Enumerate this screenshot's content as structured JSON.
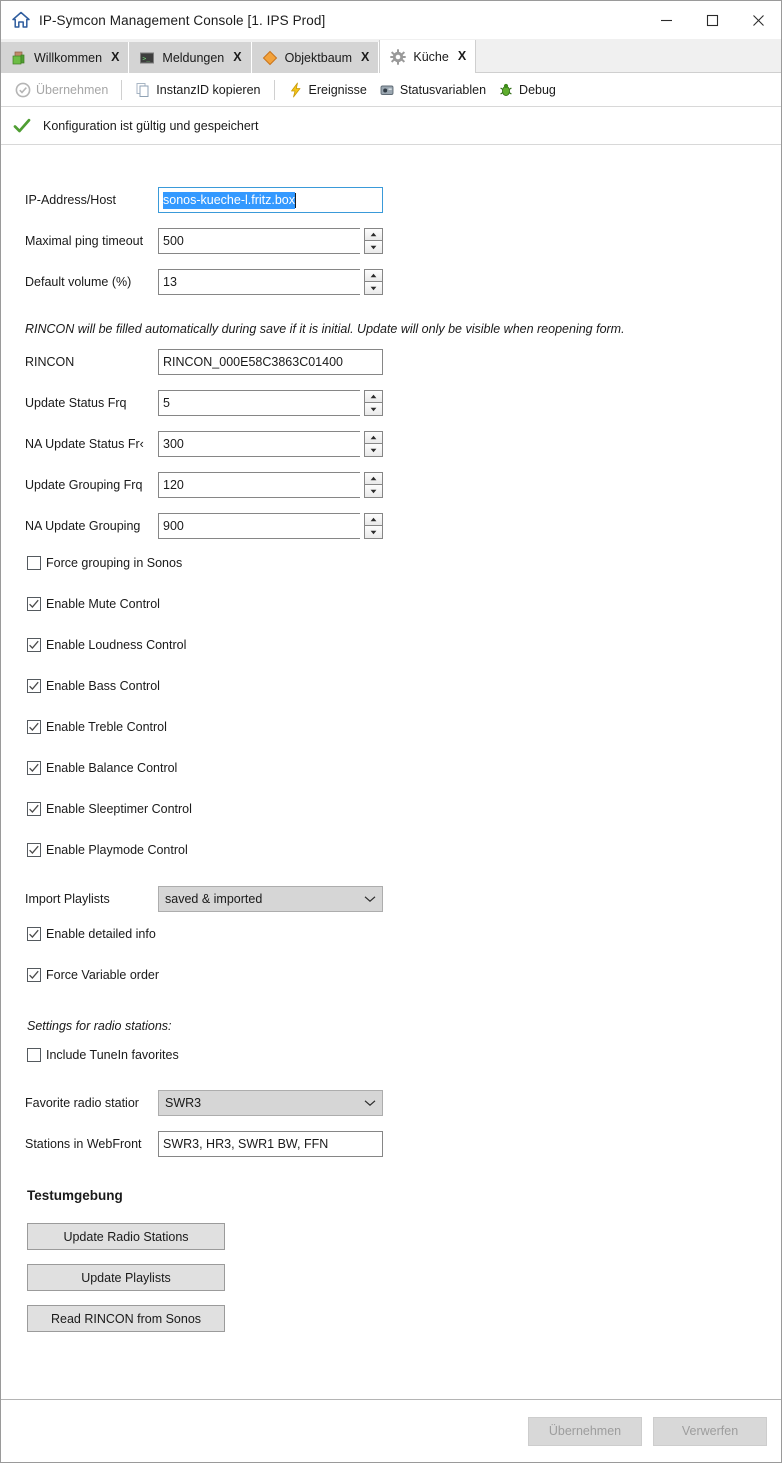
{
  "window": {
    "title": "IP-Symcon Management Console [1. IPS Prod]",
    "icon": "house-icon",
    "minimize_label": "─",
    "maximize_label": "□",
    "close_label": "✕"
  },
  "tabs": [
    {
      "label": "Willkommen",
      "icon": "green-cube-icon",
      "close": "X",
      "active": false
    },
    {
      "label": "Meldungen",
      "icon": "console-window-icon",
      "close": "X",
      "active": false
    },
    {
      "label": "Objektbaum",
      "icon": "orange-diamond-icon",
      "close": "X",
      "active": false
    },
    {
      "label": "Küche",
      "icon": "gear-icon",
      "close": "X",
      "active": true
    }
  ],
  "toolbar": {
    "apply_label": "Übernehmen",
    "apply_icon": "check-circle-icon",
    "copy_id_label": "InstanzID kopieren",
    "copy_id_icon": "copy-pages-icon",
    "events_label": "Ereignisse",
    "events_icon": "lightning-bolt-icon",
    "status_vars_label": "Statusvariablen",
    "status_vars_icon": "database-icon",
    "debug_label": "Debug",
    "debug_icon": "green-bug-icon"
  },
  "status": {
    "icon": "green-checkmark-icon",
    "text": "Konfiguration ist gültig und gespeichert"
  },
  "form": {
    "ip_address": {
      "label": "IP-Address/Host",
      "value": "sonos-kueche-l.fritz.box",
      "selected": true
    },
    "ping_timeout": {
      "label": "Maximal ping timeout",
      "value": "500"
    },
    "default_volume": {
      "label": "Default volume (%)",
      "value": "13"
    },
    "rincon_note": "RINCON will be filled automatically during save if it is initial. Update will only be visible when reopening form.",
    "rincon": {
      "label": "RINCON",
      "value": "RINCON_000E58C3863C01400"
    },
    "update_status_frq": {
      "label": "Update Status Frq",
      "value": "5"
    },
    "na_update_status_frq": {
      "label": "NA Update Status Fr‹",
      "value": "300"
    },
    "update_grouping_frq": {
      "label": "Update Grouping Frq",
      "value": "120"
    },
    "na_update_grouping": {
      "label": "NA Update Grouping",
      "value": "900"
    },
    "checkboxes": [
      {
        "label": "Force grouping in Sonos",
        "checked": false
      },
      {
        "label": "Enable Mute Control",
        "checked": true
      },
      {
        "label": "Enable Loudness Control",
        "checked": true
      },
      {
        "label": "Enable Bass Control",
        "checked": true
      },
      {
        "label": "Enable Treble Control",
        "checked": true
      },
      {
        "label": "Enable Balance Control",
        "checked": true
      },
      {
        "label": "Enable Sleeptimer Control",
        "checked": true
      },
      {
        "label": "Enable Playmode Control",
        "checked": true
      }
    ],
    "import_playlists": {
      "label": "Import Playlists",
      "value": "saved & imported"
    },
    "detailed_info": {
      "label": "Enable detailed info",
      "checked": true
    },
    "force_var_order": {
      "label": "Force Variable order",
      "checked": true
    },
    "radio_note": "Settings for radio stations:",
    "tunein": {
      "label": "Include TuneIn favorites",
      "checked": false
    },
    "favorite_station": {
      "label": "Favorite radio statior",
      "value": "SWR3"
    },
    "webfront_stations": {
      "label": "Stations in WebFront",
      "value": "SWR3, HR3, SWR1 BW, FFN"
    },
    "test_section_title": "Testumgebung",
    "test_buttons": [
      {
        "label": "Update Radio Stations"
      },
      {
        "label": "Update Playlists"
      },
      {
        "label": "Read RINCON from Sonos"
      }
    ]
  },
  "footer": {
    "apply_label": "Übernehmen",
    "discard_label": "Verwerfen"
  },
  "colors": {
    "selection_blue": "#3399ff",
    "accent_green": "#4f9e33",
    "tab_inactive": "#d4d4d4",
    "combo_bg": "#d6d6d6"
  }
}
